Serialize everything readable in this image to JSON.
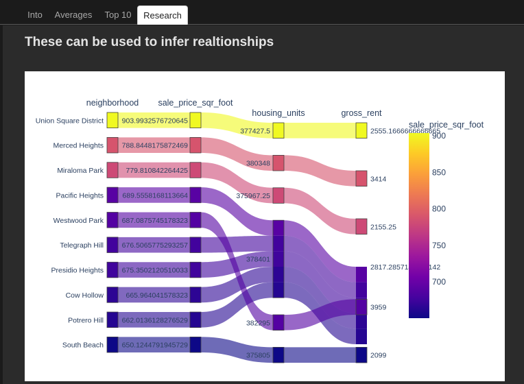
{
  "tabs": [
    {
      "label": "Into",
      "active": false
    },
    {
      "label": "Averages",
      "active": false
    },
    {
      "label": "Top 10",
      "active": false
    },
    {
      "label": "Research",
      "active": true
    }
  ],
  "heading": "These can be used to infer realtionships",
  "chart_data": {
    "type": "parallel_categories",
    "dimensions": [
      {
        "label": "neighborhood",
        "categories": [
          "Union Square District",
          "Merced Heights",
          "Miraloma Park",
          "Pacific Heights",
          "Westwood Park",
          "Telegraph Hill",
          "Presidio Heights",
          "Cow Hollow",
          "Potrero Hill",
          "South Beach"
        ]
      },
      {
        "label": "sale_price_sqr_foot",
        "categories": [
          "903.9932576720645",
          "788.8448175872469",
          "779.810842264425",
          "689.5558168113664",
          "687.0875745178323",
          "676.5065775293257",
          "675.3502120510033",
          "665.964041578323",
          "662.0136128276529",
          "650.1244791945729"
        ]
      },
      {
        "label": "housing_units",
        "categories": [
          "377427.5",
          "380348",
          "375967.25",
          "378401",
          "382295",
          "375805"
        ]
      },
      {
        "label": "gross_rent",
        "categories": [
          "2555.1666666666665",
          "3414",
          "2155.25",
          "2817.2857142857142",
          "3959",
          "2099"
        ]
      }
    ],
    "records": [
      {
        "neighborhood": "Union Square District",
        "sale_price_sqr_foot": 903.9932576720645,
        "housing_units": 377427.5,
        "gross_rent": 2555.1666666666665
      },
      {
        "neighborhood": "Merced Heights",
        "sale_price_sqr_foot": 788.8448175872469,
        "housing_units": 380348,
        "gross_rent": 3414
      },
      {
        "neighborhood": "Miraloma Park",
        "sale_price_sqr_foot": 779.810842264425,
        "housing_units": 375967.25,
        "gross_rent": 2155.25
      },
      {
        "neighborhood": "Pacific Heights",
        "sale_price_sqr_foot": 689.5558168113664,
        "housing_units": 378401,
        "gross_rent": 2817.285714285714
      },
      {
        "neighborhood": "Westwood Park",
        "sale_price_sqr_foot": 687.0875745178323,
        "housing_units": 382295,
        "gross_rent": 3959
      },
      {
        "neighborhood": "Telegraph Hill",
        "sale_price_sqr_foot": 676.5065775293257,
        "housing_units": 378401,
        "gross_rent": 2817.285714285714
      },
      {
        "neighborhood": "Presidio Heights",
        "sale_price_sqr_foot": 675.3502120510033,
        "housing_units": 378401,
        "gross_rent": 2817.285714285714
      },
      {
        "neighborhood": "Cow Hollow",
        "sale_price_sqr_foot": 665.964041578323,
        "housing_units": 378401,
        "gross_rent": 2817.285714285714
      },
      {
        "neighborhood": "Potrero Hill",
        "sale_price_sqr_foot": 662.0136128276529,
        "housing_units": 378401,
        "gross_rent": 2817.285714285714
      },
      {
        "neighborhood": "South Beach",
        "sale_price_sqr_foot": 650.1244791945729,
        "housing_units": 375805,
        "gross_rent": 2099
      }
    ],
    "display_labels": {
      "housing_units": {
        "377427.5": "377427.5",
        "380348": "380348",
        "375967.25": "375967.25",
        "378401": "378401",
        "382295": "382295",
        "375805": "375805"
      },
      "gross_rent": {
        "2555.1666666666665": "2555.1666666666665",
        "3414": "3414",
        "2155.25": "2155.25",
        "2817.2857142857142": "2817.2857142857142",
        "3959": "3959",
        "2099": "2099"
      }
    },
    "color_by": "sale_price_sqr_foot",
    "colorscale": "plasma",
    "colorbar": {
      "title": "sale_price_sqr_foot",
      "range": [
        650.1244791945729,
        903.9932576720645
      ],
      "ticks": [
        700,
        750,
        800,
        850,
        900
      ]
    },
    "colorscale_stops": [
      "#0d0887",
      "#46039f",
      "#7201a8",
      "#9c179e",
      "#bd3786",
      "#d8576b",
      "#ed7953",
      "#fb9f3a",
      "#fdca26",
      "#f0f921"
    ]
  }
}
